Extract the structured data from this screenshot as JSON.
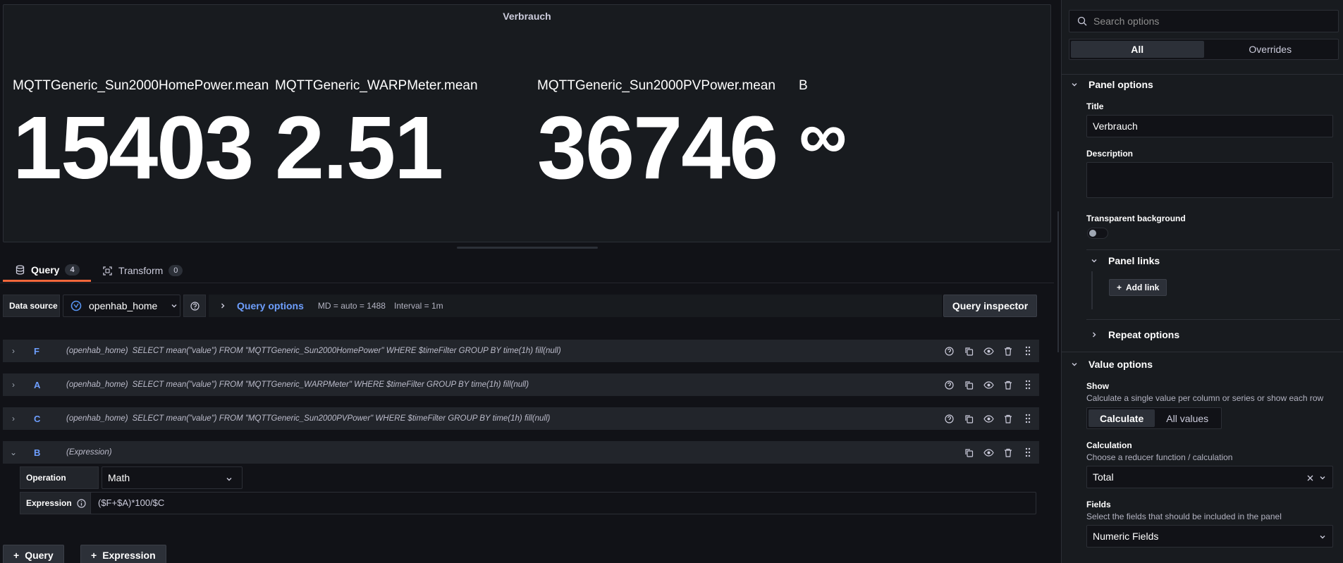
{
  "panel": {
    "title": "Verbrauch",
    "stats": [
      {
        "label": "MQTTGeneric_Sun2000HomePower.mean",
        "value": "15403"
      },
      {
        "label": "MQTTGeneric_WARPMeter.mean",
        "value": "2.51"
      },
      {
        "label": "MQTTGeneric_Sun2000PVPower.mean",
        "value": "36746"
      },
      {
        "label": "B",
        "value": "∞"
      }
    ]
  },
  "tabs": {
    "query_label": "Query",
    "query_count": "4",
    "transform_label": "Transform",
    "transform_count": "0"
  },
  "datasource": {
    "label": "Data source",
    "name": "openhab_home",
    "query_options": "Query options",
    "md": "MD = auto = 1488",
    "interval": "Interval = 1m",
    "inspector": "Query inspector"
  },
  "queries": [
    {
      "id": "F",
      "source": "(openhab_home)",
      "text": "SELECT mean(\"value\") FROM \"MQTTGeneric_Sun2000HomePower\" WHERE $timeFilter GROUP BY time(1h) fill(null)"
    },
    {
      "id": "A",
      "source": "(openhab_home)",
      "text": "SELECT mean(\"value\") FROM \"MQTTGeneric_WARPMeter\" WHERE $timeFilter GROUP BY time(1h) fill(null)"
    },
    {
      "id": "C",
      "source": "(openhab_home)",
      "text": "SELECT mean(\"value\") FROM \"MQTTGeneric_Sun2000PVPower\" WHERE $timeFilter GROUP BY time(1h) fill(null)"
    },
    {
      "id": "B",
      "source": "(Expression)",
      "text": ""
    }
  ],
  "expression": {
    "operation_label": "Operation",
    "operation_value": "Math",
    "expression_label": "Expression",
    "expression_value": "($F+$A)*100/$C"
  },
  "add_buttons": {
    "query": "Query",
    "expression": "Expression"
  },
  "options": {
    "search_placeholder": "Search options",
    "seg_all": "All",
    "seg_overrides": "Overrides",
    "panel_options": "Panel options",
    "title_label": "Title",
    "title_value": "Verbrauch",
    "description_label": "Description",
    "transparent_label": "Transparent background",
    "panel_links": "Panel links",
    "add_link": "Add link",
    "repeat_options": "Repeat options",
    "value_options": "Value options",
    "show_label": "Show",
    "show_desc": "Calculate a single value per column or series or show each row",
    "show_calculate": "Calculate",
    "show_all_values": "All values",
    "calc_label": "Calculation",
    "calc_desc": "Choose a reducer function / calculation",
    "calc_value": "Total",
    "fields_label": "Fields",
    "fields_desc": "Select the fields that should be included in the panel",
    "fields_value": "Numeric Fields"
  },
  "colors": {
    "accent": "#6e9fff",
    "tab_active": "#f2673b",
    "background": "#111217",
    "panel": "#181b1f"
  }
}
